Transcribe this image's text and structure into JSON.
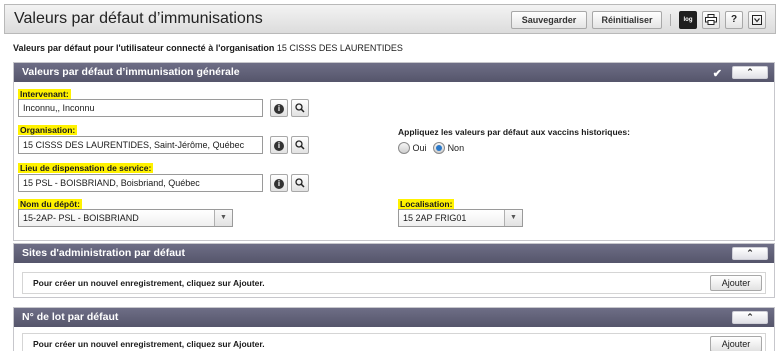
{
  "header": {
    "title": "Valeurs par défaut d’immunisations",
    "save_label": "Sauvegarder",
    "reset_label": "Réinitialiser",
    "log_label": "log",
    "help_label": "?"
  },
  "subtitle": {
    "prefix": "Valeurs par défaut pour l'utilisateur connecté à l'organisation",
    "org": "15 CISSS DES LAURENTIDES"
  },
  "general": {
    "title": "Valeurs par défaut d’immunisation générale",
    "intervenant_label": "Intervenant:",
    "intervenant_value": "Inconnu,, Inconnu",
    "organisation_label": "Organisation:",
    "organisation_value": "15 CISSS DES LAURENTIDES, Saint-Jérôme, Québec",
    "lieu_label": "Lieu de dispensation de service:",
    "lieu_value": "15 PSL - BOISBRIAND, Boisbriand, Québec",
    "depot_label": "Nom du dépôt:",
    "depot_value": "15-2AP- PSL - BOISBRIAND",
    "historique_label": "Appliquez les valeurs par défaut aux vaccins historiques:",
    "oui_label": "Oui",
    "non_label": "Non",
    "selected": "Non",
    "localisation_label": "Localisation:",
    "localisation_value": "15 2AP FRIG01"
  },
  "sites": {
    "title": "Sites d'administration par défaut",
    "empty_text": "Pour créer un nouvel enregistrement, cliquez sur Ajouter.",
    "add_label": "Ajouter"
  },
  "lot": {
    "title": "N° de lot par défaut",
    "empty_text": "Pour créer un nouvel enregistrement, cliquez sur Ajouter.",
    "add_label": "Ajouter"
  }
}
